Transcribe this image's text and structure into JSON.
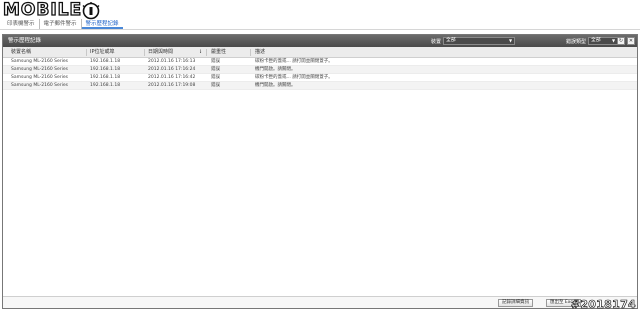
{
  "logo": {
    "text": "MOBILE"
  },
  "tabs": [
    {
      "label": "印表機警示",
      "active": false
    },
    {
      "label": "電子郵件警示",
      "active": false
    },
    {
      "label": "警示歷程記錄",
      "active": true
    }
  ],
  "panel": {
    "title": "警示歷程記錄",
    "device_filter": {
      "label": "裝置",
      "value": "全部"
    },
    "type_filter": {
      "label": "錯誤類型",
      "value": "全部"
    }
  },
  "table": {
    "columns": [
      "裝置名稱",
      "IP位址或埠",
      "日期與時間",
      "嚴重性",
      "描述"
    ],
    "rows": [
      [
        "Samsung ML-2160 Series",
        "192.168.1.18",
        "2012.01.16  17:16:13",
        "錯誤",
        "碳粉卡匣的蓋或... 請打開並關閉蓋子。"
      ],
      [
        "Samsung ML-2160 Series",
        "192.168.1.18",
        "2012.01.16  17:16:24",
        "錯誤",
        "機門開啟。請關閉。"
      ],
      [
        "Samsung ML-2160 Series",
        "192.168.1.18",
        "2012.01.16  17:16:42",
        "錯誤",
        "碳粉卡匣的蓋或... 請打開並關閉蓋子。"
      ],
      [
        "Samsung ML-2160 Series",
        "192.168.1.18",
        "2012.01.16  17:19:08",
        "錯誤",
        "機門開啟。請關閉。"
      ]
    ]
  },
  "footer": {
    "history_button": "記錄詳細資訊",
    "export_button": "匯出至 Excel"
  },
  "watermark": "#2018174"
}
